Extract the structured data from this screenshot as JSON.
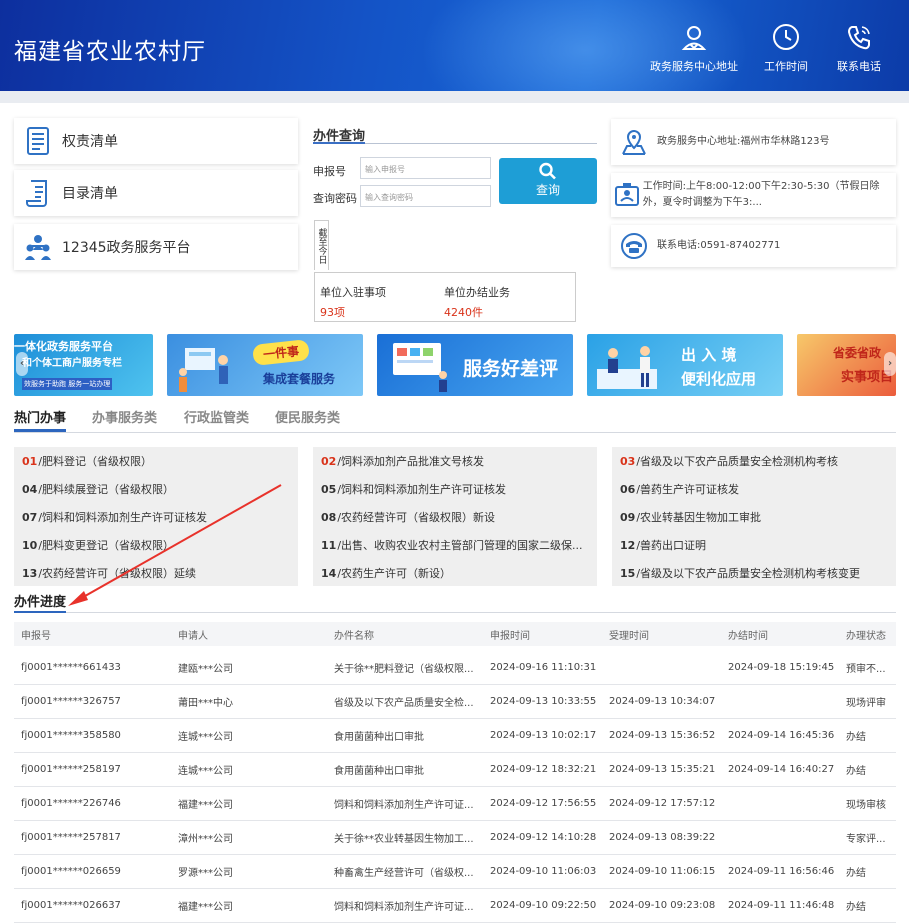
{
  "header": {
    "title": "福建省农业农村厅",
    "nav": [
      {
        "label": "政务服务中心地址",
        "icon": "location-person-icon"
      },
      {
        "label": "工作时间",
        "icon": "clock-icon"
      },
      {
        "label": "联系电话",
        "icon": "phone-icon"
      }
    ]
  },
  "left_links": [
    {
      "label": "权责清单",
      "icon": "document-list-icon"
    },
    {
      "label": "目录清单",
      "icon": "scroll-icon"
    },
    {
      "label": "12345政务服务平台",
      "icon": "people-network-icon"
    }
  ],
  "query": {
    "title": "办件查询",
    "code_label": "申报号",
    "code_placeholder": "输入申报号",
    "pwd_label": "查询密码",
    "pwd_placeholder": "输入查询密码",
    "button": "查询",
    "as_of_label": "截至今日",
    "stats": [
      {
        "label": "单位入驻事项",
        "value": "93",
        "unit": "项"
      },
      {
        "label": "单位办结业务",
        "value": "4240",
        "unit": "件"
      }
    ]
  },
  "info": [
    {
      "text": "政务服务中心地址:福州市华林路123号",
      "icon": "map-pin-icon"
    },
    {
      "text": "工作时间:上午8:00-12:00下午2:30-5:30（节假日除外，夏令时调整为下午3:...",
      "icon": "id-card-icon"
    },
    {
      "text": "联系电话:0591-87402771",
      "icon": "telephone-icon"
    }
  ],
  "banners": [
    {
      "line1": "一体化政务服务平台",
      "line2": "和个体工商户服务专栏",
      "line3": "效服务于助跑 服务一站办理",
      "color1": "#1d8ed8",
      "color2": "#4fc3ef"
    },
    {
      "tag": "一件事",
      "line1": "集成套餐服务",
      "color1": "#3b8fe0",
      "color2": "#7ec8f7"
    },
    {
      "line1": "服务好差评",
      "color1": "#1a6fd6",
      "color2": "#48a6f0"
    },
    {
      "line1": "出 入 境",
      "line2": "便利化应用",
      "color1": "#2aa1e6",
      "color2": "#78d0f5"
    },
    {
      "line1": "省委省政",
      "line2": "实事项目",
      "color1": "#f7c86a",
      "color2": "#eb5c3c"
    }
  ],
  "tabs": [
    {
      "label": "热门办事",
      "active": true
    },
    {
      "label": "办事服务类",
      "active": false
    },
    {
      "label": "行政监管类",
      "active": false
    },
    {
      "label": "便民服务类",
      "active": false
    }
  ],
  "hot_items": [
    [
      {
        "num": "01",
        "text": "/肥料登记（省级权限）"
      },
      {
        "num": "04",
        "text": "/肥料续展登记（省级权限）"
      },
      {
        "num": "07",
        "text": "/饲料和饲料添加剂生产许可证核发"
      },
      {
        "num": "10",
        "text": "/肥料变更登记（省级权限）"
      },
      {
        "num": "13",
        "text": "/农药经营许可（省级权限）延续"
      }
    ],
    [
      {
        "num": "02",
        "text": "/饲料添加剂产品批准文号核发"
      },
      {
        "num": "05",
        "text": "/饲料和饲料添加剂生产许可证核发"
      },
      {
        "num": "08",
        "text": "/农药经营许可（省级权限）新设"
      },
      {
        "num": "11",
        "text": "/出售、收购农业农村主管部门管理的国家二级保..."
      },
      {
        "num": "14",
        "text": "/农药生产许可（新设）"
      }
    ],
    [
      {
        "num": "03",
        "text": "/省级及以下农产品质量安全检测机构考核"
      },
      {
        "num": "06",
        "text": "/兽药生产许可证核发"
      },
      {
        "num": "09",
        "text": "/农业转基因生物加工审批"
      },
      {
        "num": "12",
        "text": "/兽药出口证明"
      },
      {
        "num": "15",
        "text": "/省级及以下农产品质量安全检测机构考核变更"
      }
    ]
  ],
  "progress": {
    "title": "办件进度",
    "headers": [
      "申报号",
      "申请人",
      "办件名称",
      "申报时间",
      "受理时间",
      "办结时间",
      "办理状态"
    ],
    "rows": [
      [
        "fj0001******661433",
        "建瓯***公司",
        "关于徐**肥料登记（省级权限...",
        "2024-09-16 11:10:31",
        "",
        "2024-09-18 15:19:45",
        "预审不..."
      ],
      [
        "fj0001******326757",
        "莆田***中心",
        "省级及以下农产品质量安全检...",
        "2024-09-13 10:33:55",
        "2024-09-13 10:34:07",
        "",
        "现场评审"
      ],
      [
        "fj0001******358580",
        "连城***公司",
        "食用菌菌种出口审批",
        "2024-09-13 10:02:17",
        "2024-09-13 15:36:52",
        "2024-09-14 16:45:36",
        "办结"
      ],
      [
        "fj0001******258197",
        "连城***公司",
        "食用菌菌种出口审批",
        "2024-09-12 18:32:21",
        "2024-09-13 15:35:21",
        "2024-09-14 16:40:27",
        "办结"
      ],
      [
        "fj0001******226746",
        "福建***公司",
        "饲料和饲料添加剂生产许可证...",
        "2024-09-12 17:56:55",
        "2024-09-12 17:57:12",
        "",
        "现场审核"
      ],
      [
        "fj0001******257817",
        "漳州***公司",
        "关于徐**农业转基因生物加工...",
        "2024-09-12 14:10:28",
        "2024-09-13 08:39:22",
        "",
        "专家评..."
      ],
      [
        "fj0001******026659",
        "罗源***公司",
        "种畜禽生产经营许可（省级权...",
        "2024-09-10 11:06:03",
        "2024-09-10 11:06:15",
        "2024-09-11 16:56:46",
        "办结"
      ],
      [
        "fj0001******026637",
        "福建***公司",
        "饲料和饲料添加剂生产许可证...",
        "2024-09-10 09:22:50",
        "2024-09-10 09:23:08",
        "2024-09-11 11:46:48",
        "办结"
      ]
    ]
  },
  "colors": {
    "accent": "#2d66be",
    "highlight_red": "#d9331a",
    "button": "#1e9ed6",
    "annotation_arrow": "#e8322b"
  }
}
